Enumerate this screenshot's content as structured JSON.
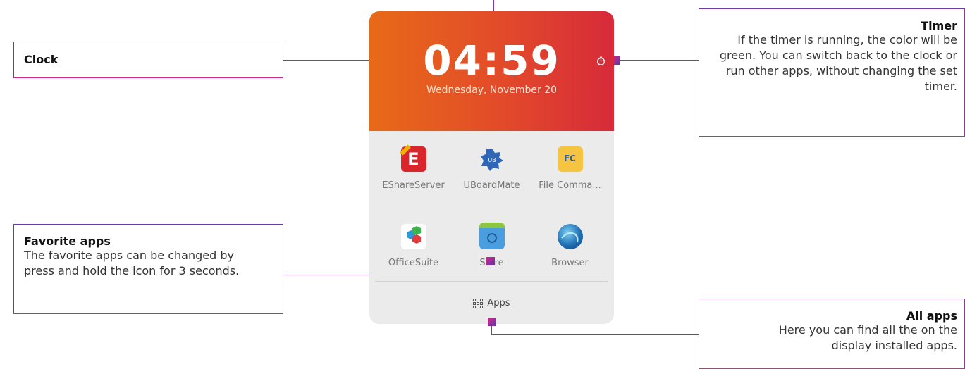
{
  "widget": {
    "clock": {
      "time": "04:59",
      "date": "Wednesday, November 20"
    },
    "favorites": [
      {
        "label": "EShareServer",
        "icon": "eshare-icon"
      },
      {
        "label": "UBoardMate",
        "icon": "uboardmate-icon"
      },
      {
        "label": "File Comma...",
        "icon": "file-commander-icon"
      },
      {
        "label": "OfficeSuite",
        "icon": "officesuite-icon"
      },
      {
        "label": "Store",
        "icon": "store-icon"
      },
      {
        "label": "Browser",
        "icon": "browser-icon"
      }
    ],
    "apps_label": "Apps"
  },
  "callouts": {
    "clock": {
      "title": "Clock"
    },
    "timer": {
      "title": "Timer",
      "desc": "If the timer is running, the color will be green. You can switch back to the clock or run other apps, without changing the set timer."
    },
    "favorites": {
      "title": "Favorite apps",
      "desc": "The favorite apps can be changed by press and hold the icon for 3 seconds."
    },
    "all_apps": {
      "title": "All apps",
      "desc": "Here you can find all the on the display installed apps."
    }
  },
  "colors": {
    "accent_purple": "#6a3aa6",
    "accent_magenta": "#d2268a",
    "clock_gradient_start": "#e86a18",
    "clock_gradient_end": "#d72a3a"
  }
}
